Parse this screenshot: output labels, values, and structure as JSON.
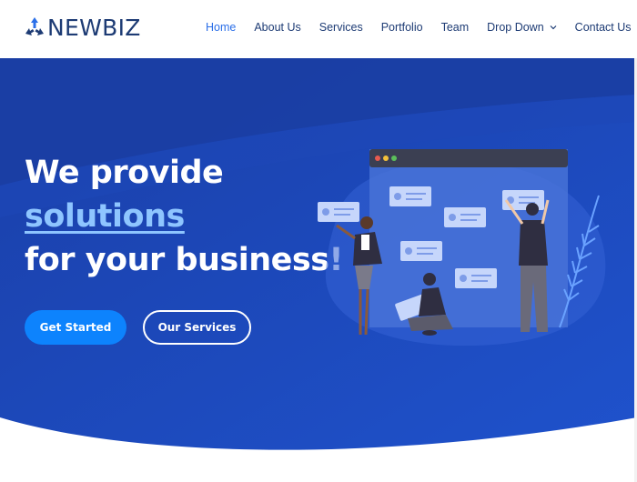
{
  "brand": {
    "name": "NEWBIZ",
    "logo_icon": "arrows-logo-icon",
    "color": "#1d3b74"
  },
  "nav": {
    "items": [
      {
        "label": "Home",
        "active": true
      },
      {
        "label": "About Us",
        "active": false
      },
      {
        "label": "Services",
        "active": false
      },
      {
        "label": "Portfolio",
        "active": false
      },
      {
        "label": "Team",
        "active": false
      },
      {
        "label": "Drop Down",
        "active": false,
        "icon": "chevron-down-icon"
      },
      {
        "label": "Contact Us",
        "active": false
      }
    ],
    "active_color": "#2b6fe8"
  },
  "hero": {
    "line1": "We provide",
    "line2": "solutions",
    "line3": "for your business!",
    "primary_button": "Get Started",
    "secondary_button": "Our Services",
    "colors": {
      "bg_dark": "#1a3fa8",
      "bg_light": "#1e4fc9",
      "accent": "#0d83fd",
      "highlight": "#8ec5ff"
    }
  }
}
